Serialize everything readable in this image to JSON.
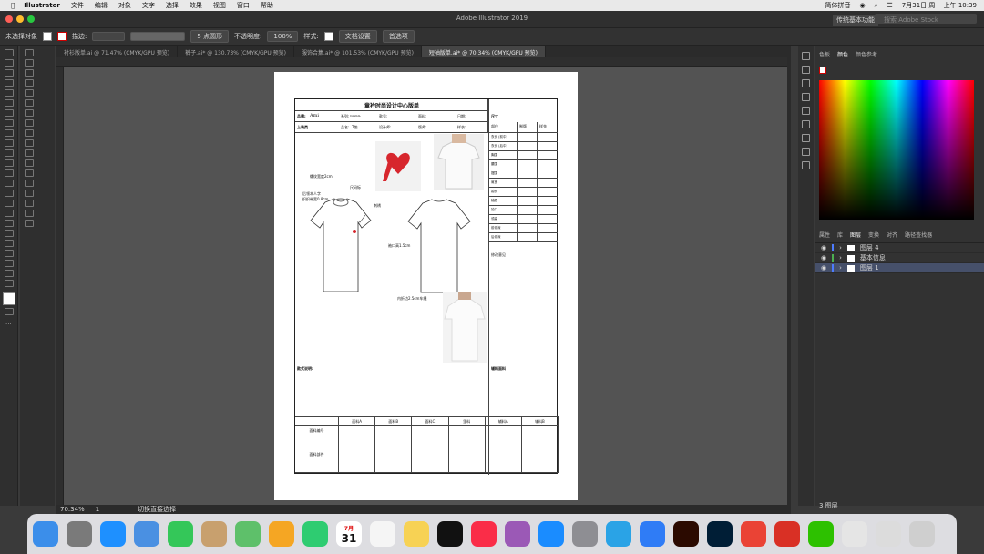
{
  "menubar": {
    "app": "Illustrator",
    "items": [
      "文件",
      "编辑",
      "对象",
      "文字",
      "选择",
      "效果",
      "视图",
      "窗口",
      "帮助"
    ],
    "status_items": [
      "简体拼音"
    ],
    "datetime": "7月31日 周一 上午 10:39"
  },
  "titlebar": {
    "title": "Adobe Illustrator 2019",
    "workspace": "传统基本功能",
    "search_placeholder": "搜索 Adobe Stock"
  },
  "controlbar": {
    "selection": "未选择对象",
    "stroke_label": "描边:",
    "brush": "5 点圆形",
    "opacity_label": "不透明度:",
    "opacity": "100%",
    "style_label": "样式:",
    "doc_setup": "文档设置",
    "prefs": "首选项"
  },
  "tabs": [
    {
      "label": "衬衫版单.ai @ 71.47% (CMYK/GPU 预览)",
      "active": false
    },
    {
      "label": "裤子.ai* @ 130.73% (CMYK/GPU 预览)",
      "active": false
    },
    {
      "label": "服饰合集.ai* @ 101.53% (CMYK/GPU 预览)",
      "active": false
    },
    {
      "label": "短袖版单.ai* @ 70.34% (CMYK/GPU 预览)",
      "active": true
    }
  ],
  "form": {
    "title": "童衿时尚设计中心版单",
    "row1": {
      "brand_label": "品牌:",
      "brand": "Ami",
      "series_label": "系列:",
      "series": "CASUAL",
      "style_no_label": "款号:",
      "color_label": "面料:",
      "date_label": "日期:"
    },
    "row2": {
      "category_label": "上装类",
      "sample_label": "品名:",
      "sample": "T恤",
      "designer_label": "设计师:",
      "pattern_label": "版师:",
      "sample_size_label": "样衣:"
    },
    "size_header": "尺寸",
    "size_cols": [
      "部位",
      "制版",
      "样衣"
    ],
    "size_rows": [
      "衣长 (前中)",
      "衣长 (后中)",
      "胸围",
      "腰围",
      "摆围",
      "肩宽",
      "袖长",
      "袖肥",
      "袖口",
      "领高",
      "前领深",
      "后领深"
    ],
    "notes_label": "修改意见",
    "annotations": {
      "a1": "螺纹宽度2cm",
      "a2": "后领本人字",
      "a3": "织织带宽0.8cm",
      "a4": "尺码标",
      "a5": "刺绣",
      "a6": "袖口高1.5cm",
      "a7": "内折边2.5cm车缝"
    },
    "style_desc_label": "款式说明:",
    "aux_label": "辅料面料",
    "fabric_cols": [
      "面料A",
      "面料B",
      "面料C",
      "里料",
      "辅料A",
      "辅料B"
    ],
    "fabric_rows": [
      "面料编号",
      "面料部件"
    ]
  },
  "panel": {
    "tabs": [
      "色板",
      "颜色",
      "颜色参考"
    ],
    "layer_tabs": [
      "属性",
      "库",
      "图层",
      "变换",
      "对齐",
      "路径查找器"
    ],
    "layers": [
      {
        "name": "图层 4",
        "color": "#4d7cff",
        "selected": false
      },
      {
        "name": "基本信息",
        "color": "#4caf50",
        "selected": false
      },
      {
        "name": "图层 1",
        "color": "#4d7cff",
        "selected": true
      }
    ],
    "count": "3 图层"
  },
  "status": {
    "zoom": "70.34%",
    "page": "1",
    "tool": "切换直接选择"
  },
  "dock_apps": [
    "访达",
    "启动台",
    "Safari",
    "邮件",
    "信息",
    "通讯录",
    "地图",
    "照片",
    "FaceTime",
    "日历",
    "提醒事项",
    "备忘录",
    "TV",
    "音乐",
    "播客",
    "App Store",
    "系统偏好设置",
    "Telegram",
    "百度网盘",
    "Illustrator",
    "Photoshop",
    "Chrome",
    "WPS",
    "微信",
    "帮助",
    "预览",
    "废纸篓"
  ],
  "calendar": {
    "month": "7月",
    "day": "31"
  },
  "colors": {
    "accent": "#46506a",
    "canvas": "#535353"
  }
}
